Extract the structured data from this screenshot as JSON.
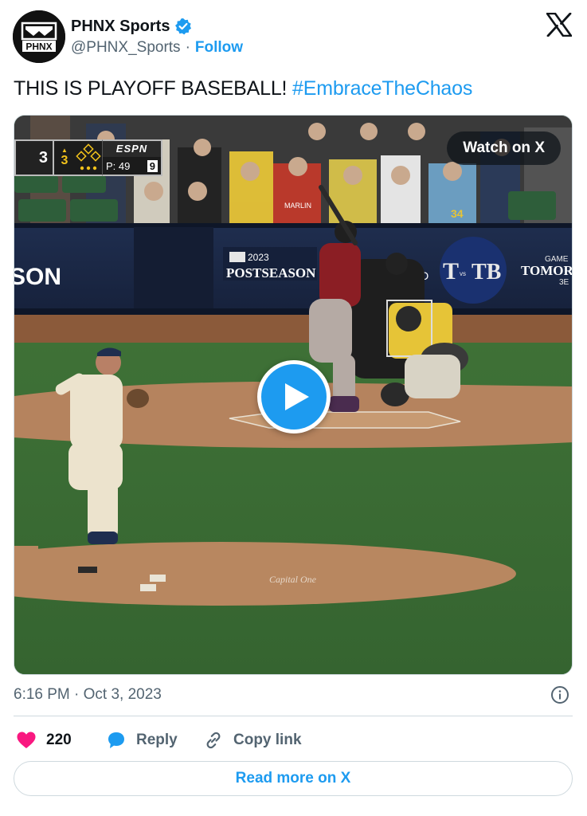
{
  "author": {
    "display_name": "PHNX Sports",
    "handle": "@PHNX_Sports",
    "separator": "·",
    "follow_label": "Follow",
    "avatar_text": "PHNX",
    "verified_icon": "verified-badge-icon"
  },
  "tweet": {
    "text": "THIS IS PLAYOFF BASEBALL!",
    "hashtag": "#EmbraceTheChaos"
  },
  "media": {
    "watch_label": "Watch on X",
    "play_icon": "play-icon",
    "scoreboard": {
      "team_score": "3",
      "inning": "3",
      "network": "ESPN",
      "pitch_label": "P: 49",
      "pitch_count": "9"
    },
    "signage": {
      "postseason_year": "2023",
      "postseason": "POSTSEASON",
      "left_banner": "SON",
      "matchup_left": "T",
      "matchup_vs": "vs",
      "matchup_right": "TB",
      "game_label": "GAME",
      "tomorrow": "TOMOR",
      "time": "3E",
      "rd": "RD",
      "jersey_left": "MARLIN",
      "jersey_number": "34",
      "mound_logo": "Capital One"
    }
  },
  "timestamp": "6:16 PM · Oct 3, 2023",
  "actions": {
    "like_count": "220",
    "reply_label": "Reply",
    "copy_label": "Copy link"
  },
  "read_more_label": "Read more on X",
  "colors": {
    "accent": "#1d9bf0",
    "like": "#f91880",
    "text": "#0f1419",
    "muted": "#536471"
  }
}
